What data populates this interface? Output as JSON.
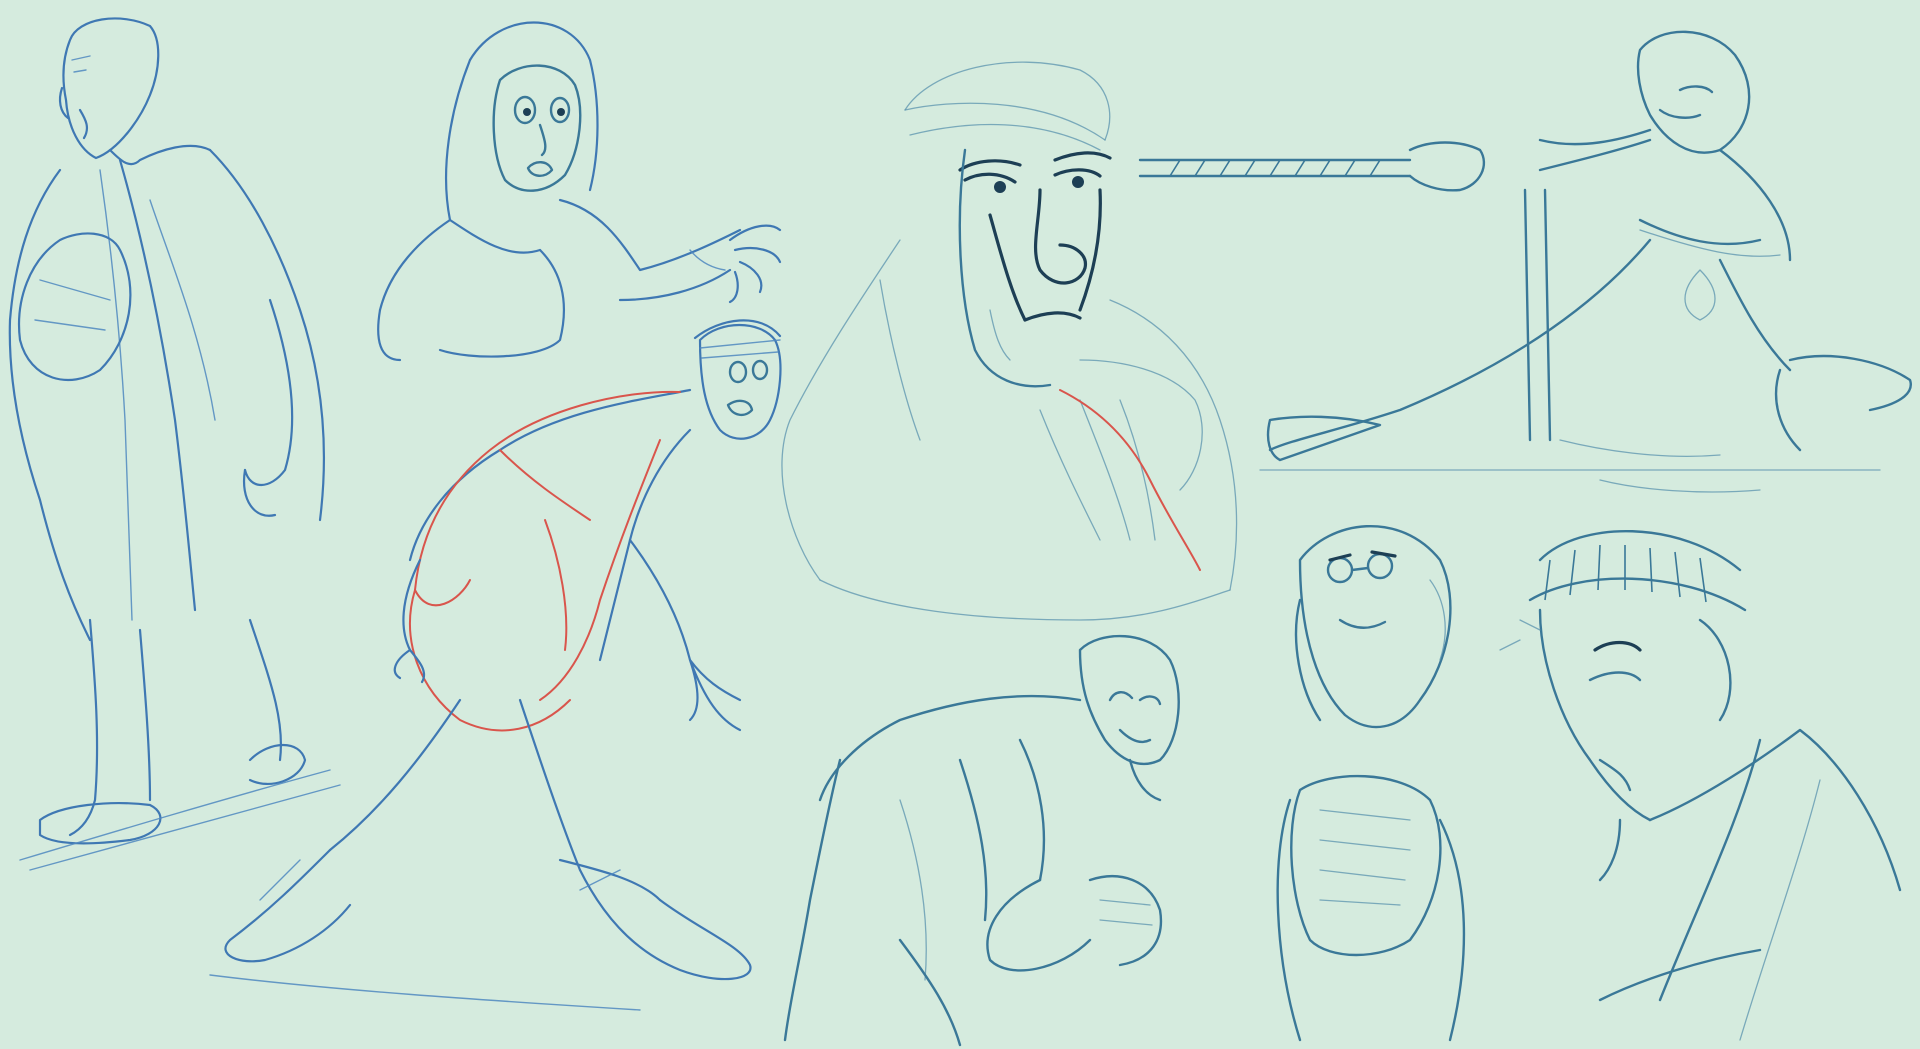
{
  "image": {
    "background_color": "#d5ebde",
    "stroke_colors": {
      "blue_sketch": "#3f78b3",
      "teal_sketch": "#3a7898",
      "red_construction": "#d9554c",
      "dark_ink": "#1d3f55"
    }
  }
}
